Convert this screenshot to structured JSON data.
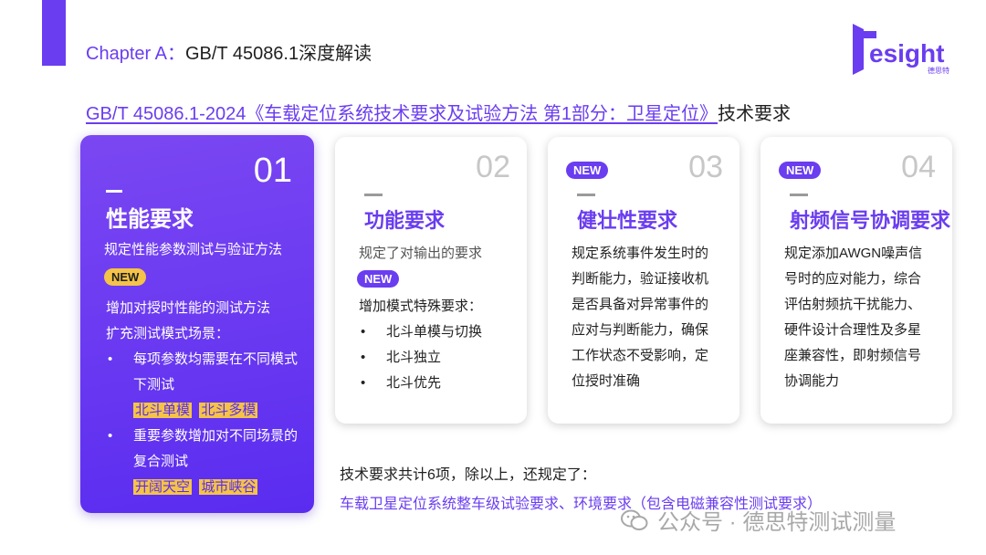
{
  "header": {
    "chapter_prefix": "Chapter A：",
    "chapter_name": "GB/T 45086.1深度解读",
    "logo_text": "esight",
    "logo_subtext": "德思特"
  },
  "headline": {
    "standard": "GB/T 45086.1-2024《车载定位系统技术要求及试验方法 第1部分：卫星定位》",
    "tail": "技术要求"
  },
  "cards": [
    {
      "num": "01",
      "title": "性能要求",
      "desc": "规定性能参数测试与验证方法",
      "badge": "NEW",
      "line1": "增加对授时性能的测试方法",
      "line2": "扩充测试模式场景：",
      "bullet1": "每项参数均需要在不同模式下测试",
      "tags1": [
        "北斗单模",
        "北斗多模"
      ],
      "bullet2": "重要参数增加对不同场景的复合测试",
      "tags2": [
        "开阔天空",
        "城市峡谷"
      ]
    },
    {
      "num": "02",
      "title": "功能要求",
      "desc": "规定了对输出的要求",
      "badge": "NEW",
      "line1": "增加模式特殊要求：",
      "bullets": [
        "北斗单模与切换",
        "北斗独立",
        "北斗优先"
      ]
    },
    {
      "num": "03",
      "badge": "NEW",
      "title": "健壮性要求",
      "body": "规定系统事件发生时的判断能力，验证接收机是否具备对异常事件的应对与判断能力，确保工作状态不受影响，定位授时准确"
    },
    {
      "num": "04",
      "badge": "NEW",
      "title": "射频信号协调要求",
      "body": "规定添加AWGN噪声信号时的应对能力，综合评估射频抗干扰能力、硬件设计合理性及多星座兼容性，即射频信号协调能力"
    }
  ],
  "summary": {
    "line1": "技术要求共计6项，除以上，还规定了：",
    "line2": "车载卫星定位系统整车级试验要求、环境要求（包含电磁兼容性测试要求）"
  },
  "watermark": "公众号 · 德思特测试测量",
  "colors": {
    "accent": "#6a3df0",
    "highlight": "#f5c347"
  }
}
